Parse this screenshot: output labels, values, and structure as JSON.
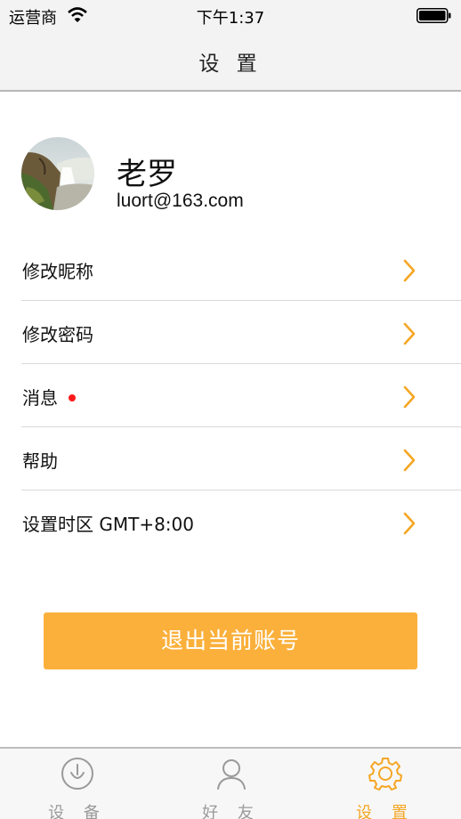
{
  "status_bar": {
    "carrier": "运营商",
    "time": "下午1:37"
  },
  "nav": {
    "title": "设 置"
  },
  "profile": {
    "name": "老罗",
    "email": "luort@163.com"
  },
  "menu": [
    {
      "label": "修改昵称",
      "badge": false
    },
    {
      "label": "修改密码",
      "badge": false
    },
    {
      "label": "消息",
      "badge": true
    },
    {
      "label": "帮助",
      "badge": false
    },
    {
      "label": "设置时区 GMT+8:00",
      "badge": false
    }
  ],
  "logout": {
    "label": "退出当前账号"
  },
  "tabbar": {
    "tabs": [
      {
        "label": "设 备",
        "icon": "device-icon",
        "active": false
      },
      {
        "label": "好 友",
        "icon": "person-icon",
        "active": false
      },
      {
        "label": "设 置",
        "icon": "gear-icon",
        "active": true
      }
    ]
  },
  "colors": {
    "accent": "#fbb03b",
    "active_tab": "#f5a623",
    "badge": "#ff1a1a"
  }
}
